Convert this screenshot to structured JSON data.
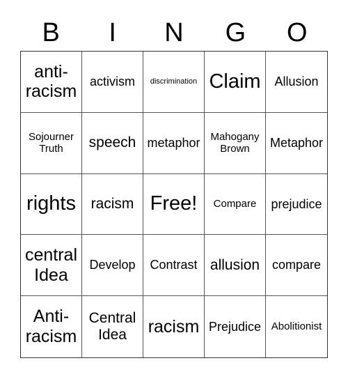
{
  "header": {
    "letters": [
      "B",
      "I",
      "N",
      "G",
      "O"
    ]
  },
  "board": {
    "rows": [
      [
        {
          "text": "anti-\nracism",
          "size": "xl"
        },
        {
          "text": "activism",
          "size": "md"
        },
        {
          "text": "discrimination",
          "size": "xs"
        },
        {
          "text": "Claim",
          "size": "xxl"
        },
        {
          "text": "Allusion",
          "size": "md"
        }
      ],
      [
        {
          "text": "Sojourner Truth",
          "size": "sm"
        },
        {
          "text": "speech",
          "size": "lg"
        },
        {
          "text": "metaphor",
          "size": "md"
        },
        {
          "text": "Mahogany Brown",
          "size": "sm"
        },
        {
          "text": "Metaphor",
          "size": "md"
        }
      ],
      [
        {
          "text": "rights",
          "size": "xxl"
        },
        {
          "text": "racism",
          "size": "lg"
        },
        {
          "text": "Free!",
          "size": "xxl"
        },
        {
          "text": "Compare",
          "size": "sm"
        },
        {
          "text": "prejudice",
          "size": "md"
        }
      ],
      [
        {
          "text": "central Idea",
          "size": "xl"
        },
        {
          "text": "Develop",
          "size": "md"
        },
        {
          "text": "Contrast",
          "size": "md"
        },
        {
          "text": "allusion",
          "size": "lg"
        },
        {
          "text": "compare",
          "size": "md"
        }
      ],
      [
        {
          "text": "Anti-\nracism",
          "size": "xl"
        },
        {
          "text": "Central Idea",
          "size": "lg"
        },
        {
          "text": "racism",
          "size": "xl"
        },
        {
          "text": "Prejudice",
          "size": "md"
        },
        {
          "text": "Abolitionist",
          "size": "sm"
        }
      ]
    ]
  }
}
